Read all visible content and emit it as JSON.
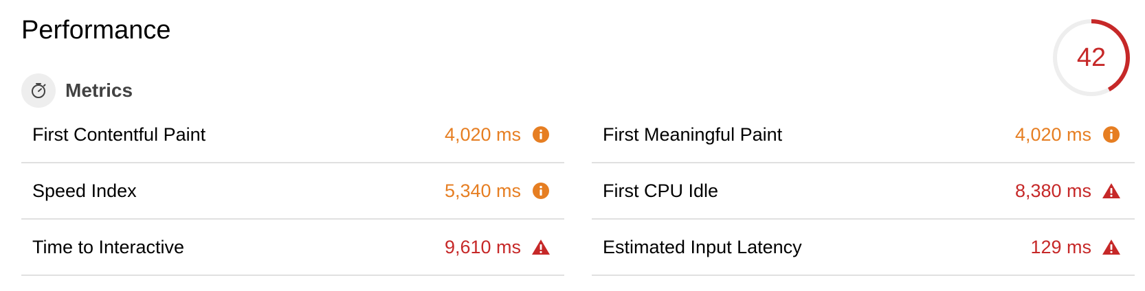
{
  "header": {
    "title": "Performance"
  },
  "score": {
    "value": "42",
    "fraction": 0.42,
    "color": "#c62828",
    "track_color": "#eeeeee"
  },
  "section": {
    "title": "Metrics",
    "icon": "stopwatch-icon"
  },
  "colors": {
    "average": "#e67e22",
    "fail": "#c62828"
  },
  "metrics": {
    "left": [
      {
        "label": "First Contentful Paint",
        "value": "4,020 ms",
        "status": "average",
        "icon": "info-icon"
      },
      {
        "label": "Speed Index",
        "value": "5,340 ms",
        "status": "average",
        "icon": "info-icon"
      },
      {
        "label": "Time to Interactive",
        "value": "9,610 ms",
        "status": "fail",
        "icon": "warning-icon"
      }
    ],
    "right": [
      {
        "label": "First Meaningful Paint",
        "value": "4,020 ms",
        "status": "average",
        "icon": "info-icon"
      },
      {
        "label": "First CPU Idle",
        "value": "8,380 ms",
        "status": "fail",
        "icon": "warning-icon"
      },
      {
        "label": "Estimated Input Latency",
        "value": "129 ms",
        "status": "fail",
        "icon": "warning-icon"
      }
    ]
  }
}
